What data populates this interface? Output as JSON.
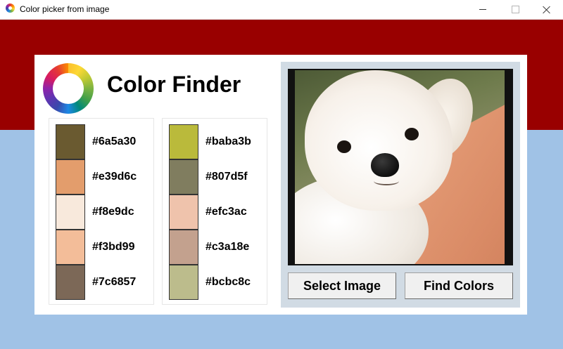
{
  "window": {
    "title": "Color picker from image"
  },
  "app": {
    "heading": "Color Finder"
  },
  "palette_left": [
    {
      "hex": "#6a5a30",
      "color": "#6a5a30"
    },
    {
      "hex": "#e39d6c",
      "color": "#e39d6c"
    },
    {
      "hex": "#f8e9dc",
      "color": "#f8e9dc"
    },
    {
      "hex": "#f3bd99",
      "color": "#f3bd99"
    },
    {
      "hex": "#7c6857",
      "color": "#7c6857"
    }
  ],
  "palette_right": [
    {
      "hex": "#baba3b",
      "color": "#baba3b"
    },
    {
      "hex": "#807d5f",
      "color": "#807d5f"
    },
    {
      "hex": "#efc3ac",
      "color": "#efc3ac"
    },
    {
      "hex": "#c3a18e",
      "color": "#c3a18e"
    },
    {
      "hex": "#bcbc8c",
      "color": "#bcbc8c"
    }
  ],
  "buttons": {
    "select_image": "Select Image",
    "find_colors": "Find Colors"
  },
  "colors": {
    "header_band": "#990000",
    "background": "#a0c2e6",
    "image_panel": "#d1dbe4"
  }
}
